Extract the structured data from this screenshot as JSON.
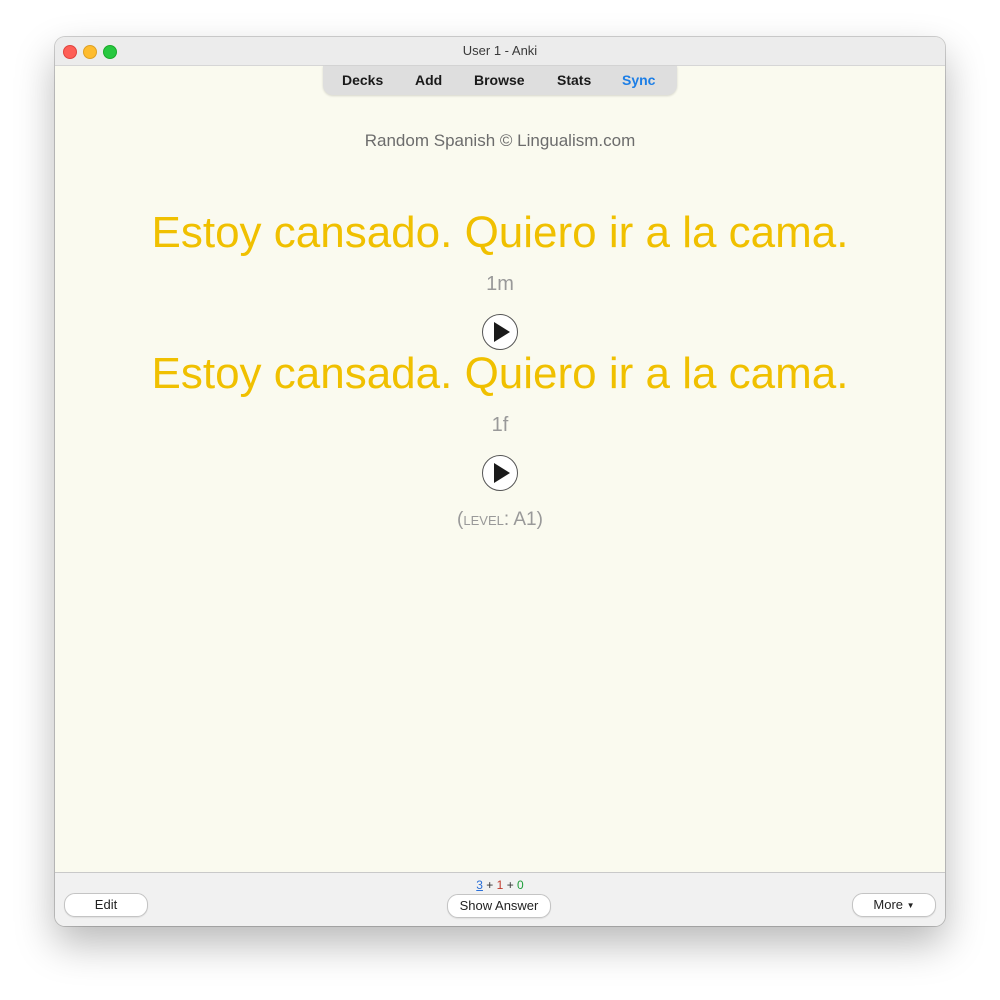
{
  "window": {
    "title": "User 1 - Anki"
  },
  "toolbar": {
    "decks": "Decks",
    "add": "Add",
    "browse": "Browse",
    "stats": "Stats",
    "sync": "Sync"
  },
  "card": {
    "source": "Random Spanish © Lingualism.com",
    "sentence_1": "Estoy cansado. Quiero ir a la cama.",
    "tag_1": "1m",
    "sentence_2": "Estoy cansada. Quiero ir a la cama.",
    "tag_2": "1f",
    "level": "(level: A1)"
  },
  "bottom": {
    "edit_label": "Edit",
    "show_answer_label": "Show Answer",
    "more_label": "More",
    "counts": {
      "new": "3",
      "learning": "1",
      "review": "0",
      "sep": "+"
    }
  },
  "icons": {
    "play": "play-icon",
    "more_caret": "caret-down-icon"
  },
  "colors": {
    "accent_sync": "#1c7ee6",
    "sentence": "#f0c000",
    "card_bg": "#fafaef",
    "count_new": "#2a6fd8",
    "count_learning": "#c0392b",
    "count_review": "#1e9e3a"
  }
}
